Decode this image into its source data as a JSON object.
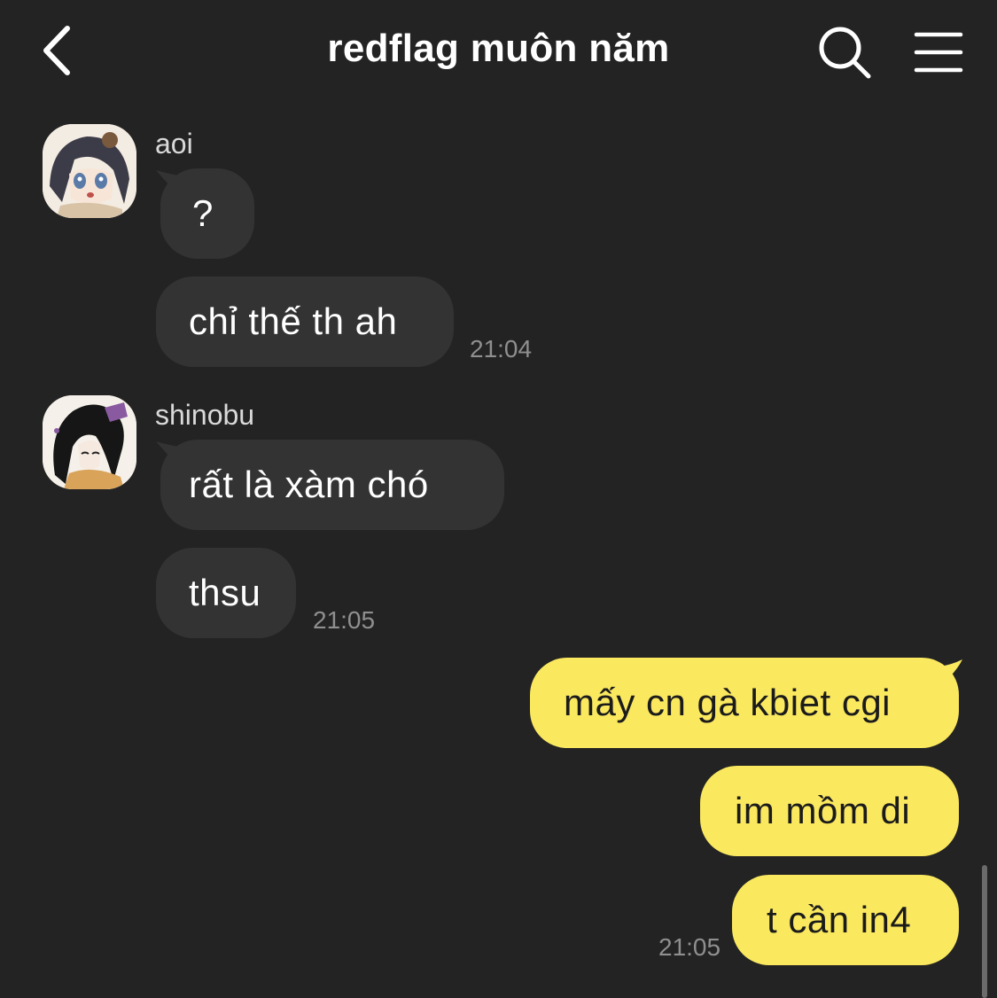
{
  "header": {
    "title": "redflag muôn năm",
    "back_icon": "chevron-left-icon",
    "search_icon": "search-icon",
    "menu_icon": "hamburger-menu-icon"
  },
  "colors": {
    "background": "#232323",
    "incoming_bubble": "#333333",
    "outgoing_bubble": "#fae85f",
    "timestamp": "#8f8f8f"
  },
  "conversation": {
    "groups": [
      {
        "sender": "aoi",
        "avatar_icon": "anime-girl-avatar",
        "messages": [
          "?",
          "chỉ thế th ah"
        ],
        "time": "21:04"
      },
      {
        "sender": "shinobu",
        "avatar_icon": "anime-girl-avatar",
        "messages": [
          "rất là xàm chó",
          "thsu"
        ],
        "time": "21:05"
      }
    ],
    "outgoing": {
      "messages": [
        "mấy cn gà kbiet cgi",
        "im mồm di",
        "t cần in4"
      ],
      "time": "21:05"
    }
  }
}
